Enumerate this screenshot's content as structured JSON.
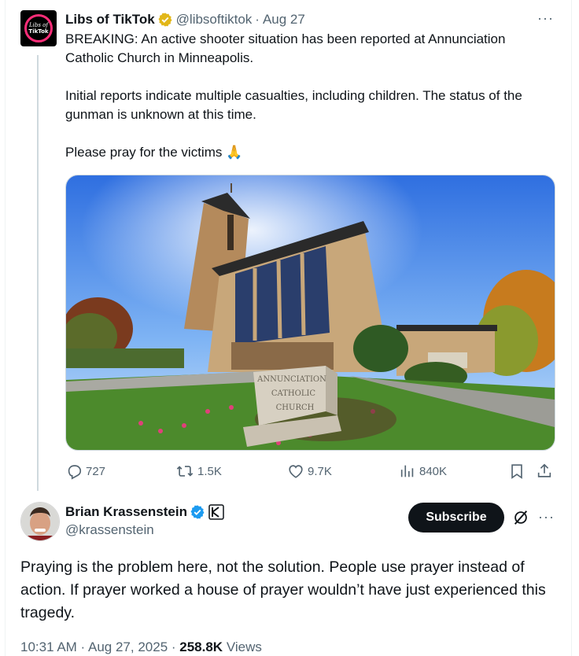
{
  "original_tweet": {
    "author_name": "Libs of TikTok",
    "avatar_text_1": "Libs of",
    "avatar_text_2": "TikTok",
    "handle": "@libsoftiktok",
    "date": "Aug 27",
    "paragraphs": [
      "BREAKING: An active shooter situation has been reported at Annunciation Catholic Church in Minneapolis.",
      "Initial reports indicate multiple casualties, including children. The status of the gunman is unknown at this time.",
      "Please pray for the victims 🙏"
    ],
    "photo": {
      "sign_lines": [
        "ANNUNCIATION",
        "CATHOLIC",
        "CHURCH"
      ]
    },
    "stats": {
      "replies": "727",
      "reposts": "1.5K",
      "likes": "9.7K",
      "views": "840K"
    },
    "more_label": "···"
  },
  "reply": {
    "author_name": "Brian Krassenstein",
    "handle": "@krassenstein",
    "subscribe_label": "Subscribe",
    "text": "Praying is the problem here, not the solution. People use prayer instead of action. If prayer worked a house of prayer wouldn’t have just experienced this tragedy.",
    "time": "10:31 AM",
    "date": "Aug 27, 2025",
    "views_count": "258.8K",
    "views_label": "Views",
    "separator": " · ",
    "more_label": "···"
  },
  "colors": {
    "verified_gold": "#e2b719",
    "verified_blue": "#1d9bf0",
    "text": "#0f1419",
    "secondary": "#536471"
  }
}
